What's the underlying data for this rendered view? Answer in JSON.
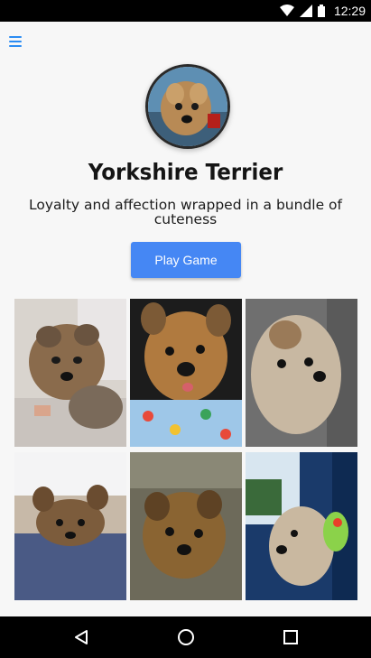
{
  "status_bar": {
    "time": "12:29"
  },
  "profile": {
    "title": "Yorkshire Terrier",
    "subtitle": "Loyalty and affection wrapped in a bundle of cuteness",
    "play_button": "Play Game"
  },
  "gallery": {
    "photos": [
      {
        "name": "yorkie-lying-on-blanket"
      },
      {
        "name": "yorkie-in-colorful-shirt"
      },
      {
        "name": "yorkie-in-car"
      },
      {
        "name": "yorkie-on-bed"
      },
      {
        "name": "yorkie-on-cushion"
      },
      {
        "name": "yorkie-at-car-window"
      }
    ]
  },
  "colors": {
    "accent": "#4587f4",
    "menu_icon": "#2b8cf3",
    "background": "#f7f7f7"
  },
  "nav_bar": {
    "icons": [
      "back-icon",
      "home-icon",
      "recents-icon"
    ]
  }
}
